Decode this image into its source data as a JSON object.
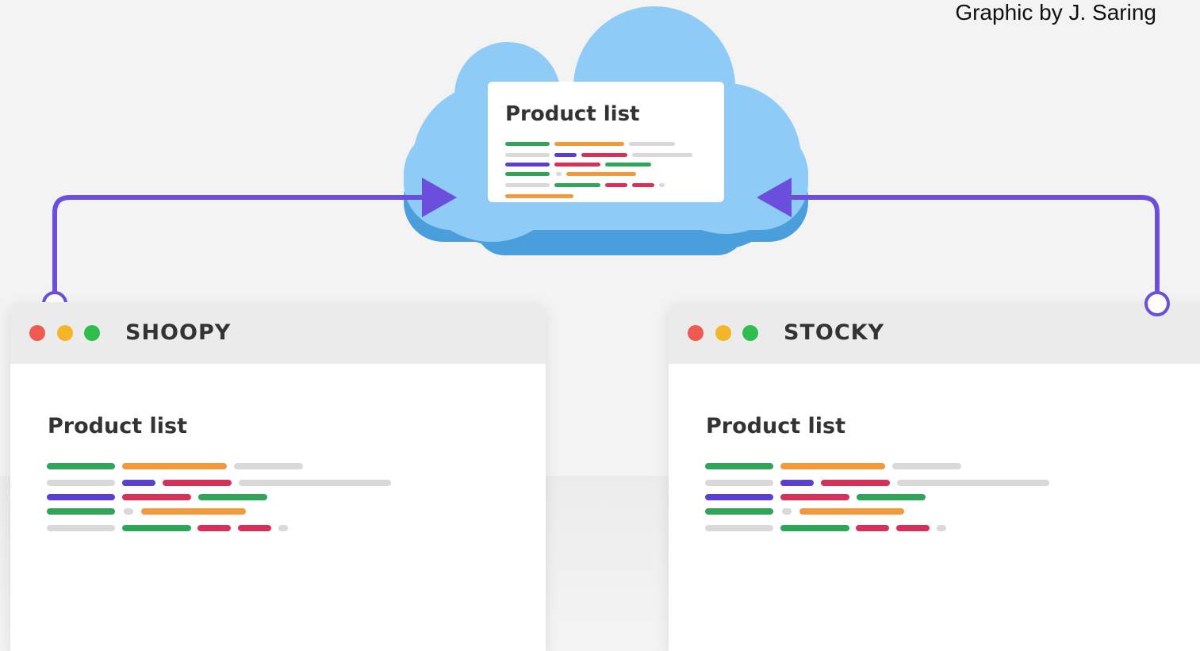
{
  "credit": "Graphic by J. Saring",
  "cloud": {
    "title": "Product list"
  },
  "windows": [
    {
      "app_name": "SHOOPY",
      "title": "Product list"
    },
    {
      "app_name": "STOCKY",
      "title": "Product list"
    }
  ],
  "colors": {
    "background": "#f3f3f3",
    "cloud_light": "#8ecbf6",
    "cloud_dark": "#4a9edc",
    "connector": "#6b4fdc",
    "line_green": "#2fa55a",
    "line_orange": "#f2993c",
    "line_gray": "#d9d9d9",
    "line_purple": "#5a3fd0",
    "line_red": "#d7315a",
    "dot_red": "#ee5a4f",
    "dot_yellow": "#f5b52a",
    "dot_green": "#2fbd4e"
  },
  "icons": [
    "cloud-icon",
    "arrow-right-icon",
    "arrow-left-icon",
    "connector-node-icon",
    "window-dots-icon"
  ]
}
